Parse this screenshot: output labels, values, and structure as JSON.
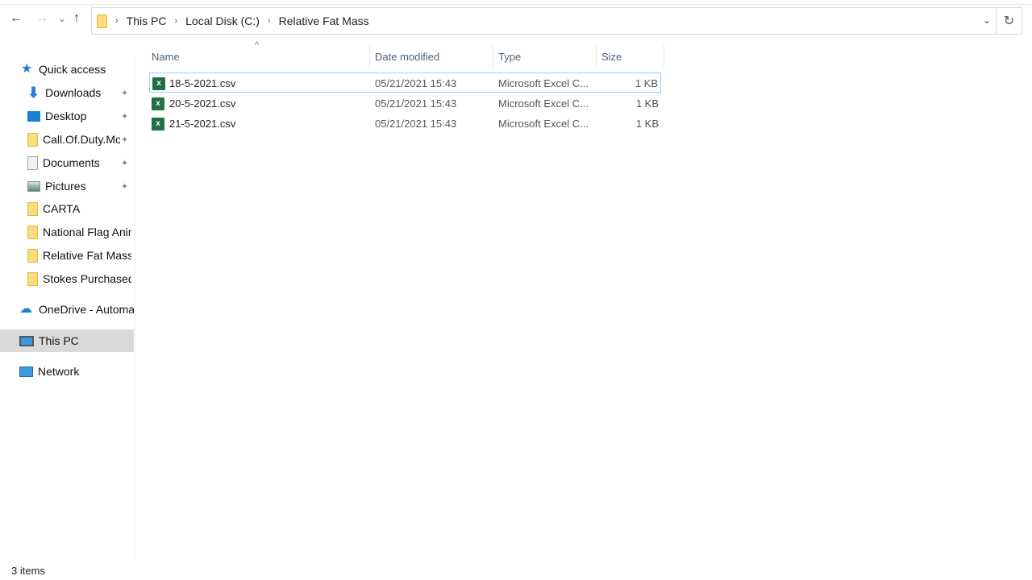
{
  "nav": {
    "back": "←",
    "forward": "→",
    "recent": "⌄",
    "up": "↑"
  },
  "address": {
    "crumbs": [
      "This PC",
      "Local Disk (C:)",
      "Relative Fat Mass"
    ],
    "separator": "›",
    "dropdown": "⌄",
    "refresh": "↻"
  },
  "sidebar": {
    "quick_access": "Quick access",
    "items": [
      {
        "label": "Downloads",
        "pinned": true
      },
      {
        "label": "Desktop",
        "pinned": true
      },
      {
        "label": "Call.Of.Duty.Modern",
        "pinned": true
      },
      {
        "label": "Documents",
        "pinned": true
      },
      {
        "label": "Pictures",
        "pinned": true
      },
      {
        "label": "CARTA"
      },
      {
        "label": "National  Flag Animation"
      },
      {
        "label": "Relative Fat Mass (R)"
      },
      {
        "label": "Stokes Purchased o"
      }
    ],
    "pin": "📌",
    "onedrive": "OneDrive - Automation",
    "this_pc": "This PC",
    "network": "Network"
  },
  "columns": {
    "name": "Name",
    "date": "Date modified",
    "type": "Type",
    "size": "Size",
    "sort_indicator": "^"
  },
  "files": [
    {
      "name": "18-5-2021.csv",
      "date": "05/21/2021 15:43",
      "type": "Microsoft Excel C...",
      "size": "1 KB"
    },
    {
      "name": "20-5-2021.csv",
      "date": "05/21/2021 15:43",
      "type": "Microsoft Excel C...",
      "size": "1 KB"
    },
    {
      "name": "21-5-2021.csv",
      "date": "05/21/2021 15:43",
      "type": "Microsoft Excel C...",
      "size": "1 KB"
    }
  ],
  "file_icon_letter": "x",
  "status": "3 items"
}
